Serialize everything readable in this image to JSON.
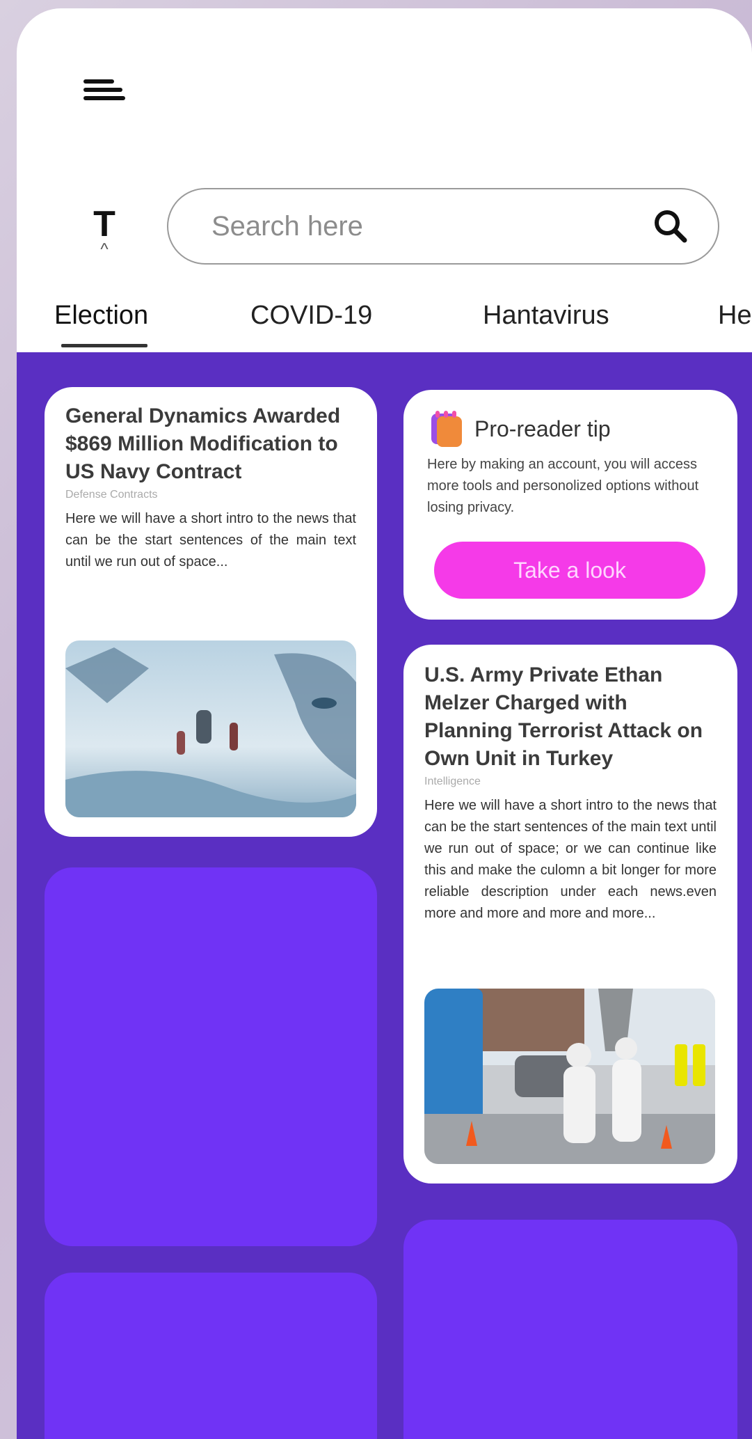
{
  "header": {
    "menu_icon": "menu-icon",
    "text_size_label": "T",
    "text_size_caret": "^"
  },
  "search": {
    "placeholder": "Search here",
    "value": "",
    "icon": "search-icon"
  },
  "tabs": [
    {
      "label": "Election",
      "active": true
    },
    {
      "label": "COVID-19",
      "active": false
    },
    {
      "label": "Hantavirus",
      "active": false
    },
    {
      "label": "He",
      "active": false
    }
  ],
  "colors": {
    "feed_background": "#5a2fc2",
    "placeholder_card": "#7033f5",
    "tip_button": "#f53ae8"
  },
  "cards": {
    "news1": {
      "title": "General Dynamics Awarded $869 Million Modification to US Navy Contract",
      "category": "Defense Contracts",
      "intro": "Here we will have a short intro to the news that can be the start sentences of the main text until we run out of space..."
    },
    "tip": {
      "icon": "notes-icon",
      "title": "Pro-reader tip",
      "text": "Here by making an account, you will access more tools and personolized options without losing privacy.",
      "button_label": "Take a look"
    },
    "news2": {
      "title": "U.S. Army Private Ethan Melzer Charged with Planning Terrorist Attack on Own Unit in Turkey",
      "category": "Intelligence",
      "intro": "Here we will have a short intro to the news that can be the start sentences of the main text until we run out of space; or we can continue like this and make the culomn a bit longer for more reliable description under each news.even more and more and more and more..."
    }
  }
}
